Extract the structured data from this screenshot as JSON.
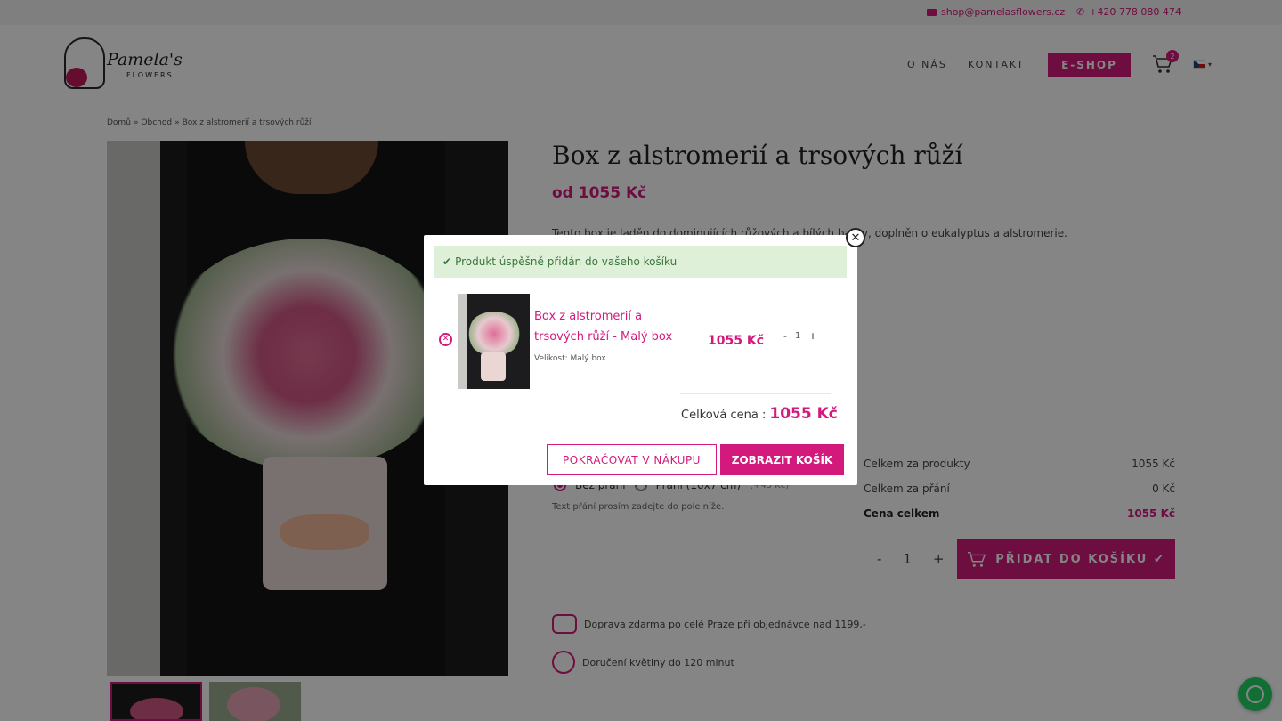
{
  "topbar": {
    "email": "shop@pamelasflowers.cz",
    "phone": "+420 778 080 474"
  },
  "header": {
    "logo_text": "Pamela's",
    "logo_subtext": "FLOWERS",
    "nav": [
      "O NÁS",
      "KONTAKT"
    ],
    "eshop_label": "E-SHOP",
    "cart_count": "2",
    "language": "cs"
  },
  "breadcrumb": [
    "Domů",
    "»",
    "Obchod",
    "»",
    "Box z alstromerií a trsových růží"
  ],
  "product": {
    "title": "Box z alstromerií a trsových růží",
    "price": "od 1055 Kč",
    "description": "Tento box je laděn do dominujících růžových a bílých barev, doplněn o eukalyptus a alstromerie.",
    "wish_options": [
      "Bez přání",
      "Přání (10x7 cm)",
      "(+45 Kč)"
    ],
    "wish_note": "Text přání prosím zadejte do pole níže.",
    "summary": [
      {
        "label": "Celkem za produkty",
        "value": "1055 Kč"
      },
      {
        "label": "Celkem za přání",
        "value": "0 Kč"
      },
      {
        "label": "Cena celkem",
        "value": "1055 Kč"
      }
    ],
    "qty": {
      "minus": "-",
      "value": "1",
      "plus": "+"
    },
    "add_to_cart_label": "PŘIDAT DO KOŠÍKU ✔",
    "info": [
      "Doprava zdarma po celé Praze při objednávce nad 1199,-",
      "Doručení květiny do 120 minut"
    ]
  },
  "modal": {
    "close_glyph": "✕",
    "success_check": "✔",
    "success_message": "Produkt úspěšně přidán do vašeho košíku",
    "remove_glyph": "✕",
    "item": {
      "name": "Box z alstromerií a trsových růží - Malý box",
      "variant": "Velikost: Malý box",
      "price": "1055 Kč",
      "qty_minus": "-",
      "qty_value": "1",
      "qty_plus": "+"
    },
    "total_label": "Celková cena :",
    "total_value": "1055 Kč",
    "continue_label": "POKRAČOVAT V NÁKUPU",
    "view_cart_label": "ZOBRAZIT KOŠÍK"
  },
  "colors": {
    "brand": "#d3197b",
    "success_bg": "#dff0d8",
    "success_text": "#3c763d",
    "whatsapp": "#25d366"
  },
  "icons": [
    "mail-icon",
    "phone-icon",
    "cart-icon",
    "flag-cz-icon",
    "close-icon",
    "check-icon",
    "remove-icon",
    "delivery-van-icon",
    "stopwatch-icon",
    "whatsapp-icon"
  ]
}
